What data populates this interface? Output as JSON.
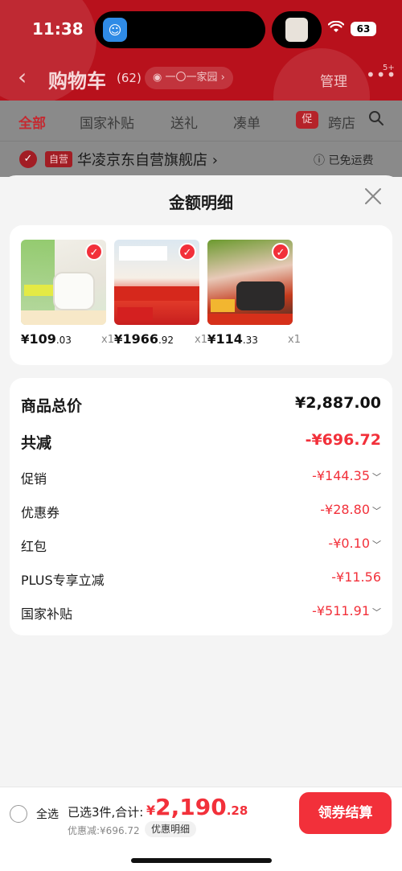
{
  "status": {
    "time": "11:38",
    "battery": "63"
  },
  "nav": {
    "title": "购物车",
    "count": "(62)",
    "address": "一〇一家园",
    "manage": "管理",
    "more_badge": "5+"
  },
  "tabs": [
    {
      "label": "全部"
    },
    {
      "label": "国家补贴"
    },
    {
      "label": "送礼"
    },
    {
      "label": "凑单"
    },
    {
      "label": "跨店"
    }
  ],
  "promo_tag": "促",
  "store": {
    "self_tag": "自营",
    "name": "华凌京东自营旗舰店",
    "shipping": "已免运费"
  },
  "sheet": {
    "title": "金额明细",
    "products": [
      {
        "yen": "¥",
        "price_int": "109",
        "price_dec": ".03",
        "qty": "x1"
      },
      {
        "yen": "¥",
        "price_int": "1966",
        "price_dec": ".92",
        "qty": "x1"
      },
      {
        "yen": "¥",
        "price_int": "114",
        "price_dec": ".33",
        "qty": "x1"
      }
    ],
    "details": [
      {
        "label": "商品总价",
        "value": "¥2,887.00"
      },
      {
        "label": "共减",
        "value": "-¥696.72"
      },
      {
        "label": "促销",
        "value": "-¥144.35"
      },
      {
        "label": "优惠券",
        "value": "-¥28.80"
      },
      {
        "label": "红包",
        "value": "-¥0.10"
      },
      {
        "label": "PLUS专享立减",
        "value": "-¥11.56"
      },
      {
        "label": "国家补贴",
        "value": "-¥511.91"
      }
    ]
  },
  "bottom": {
    "select_all": "全选",
    "summary": "已选3件,合计:",
    "total_yen": "¥",
    "total_int": "2,190",
    "total_dec": ".28",
    "discount": "优惠减:¥696.72",
    "detail_link": "优惠明细",
    "checkout": "领券结算"
  },
  "colors": {
    "accent": "#f2303a",
    "header": "#b8111c"
  }
}
